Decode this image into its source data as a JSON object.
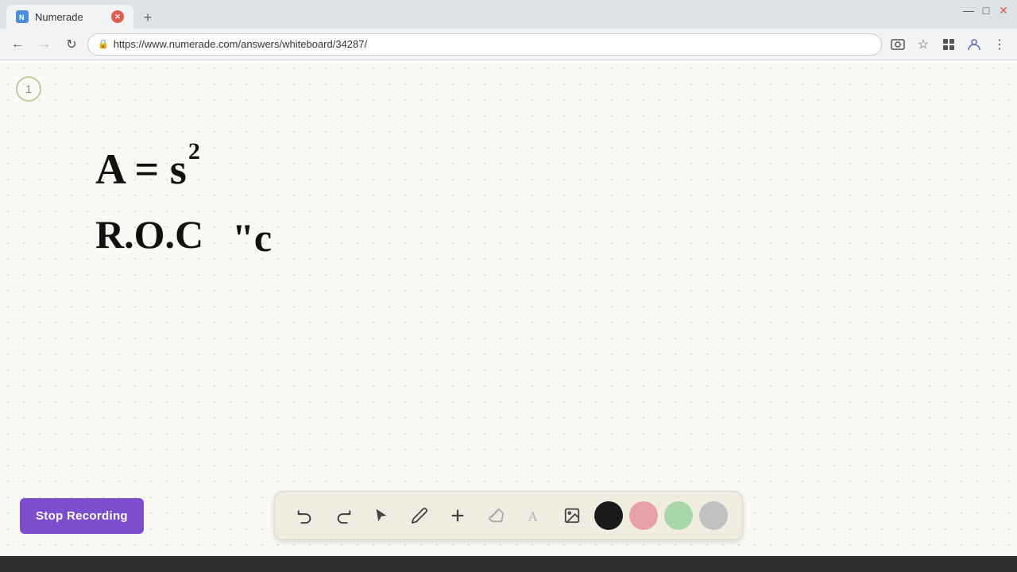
{
  "browser": {
    "tab_title": "Numerade",
    "tab_favicon": "N",
    "url": "https://www.numerade.com/answers/whiteboard/34287/",
    "new_tab_label": "+",
    "back_disabled": false,
    "forward_disabled": true,
    "reload_label": "⟳"
  },
  "toolbar": {
    "undo_label": "↩",
    "redo_label": "↪",
    "select_label": "▶",
    "pen_label": "✏",
    "add_label": "+",
    "eraser_label": "⌫",
    "text_label": "A",
    "image_label": "🖼",
    "colors": [
      {
        "name": "black",
        "hex": "#1a1a1a"
      },
      {
        "name": "pink",
        "hex": "#e8a0a8"
      },
      {
        "name": "green",
        "hex": "#a8d8a8"
      },
      {
        "name": "gray",
        "hex": "#c0c0c0"
      }
    ]
  },
  "whiteboard": {
    "page_number": "1",
    "formula1": "A = s",
    "formula1_exp": "2",
    "formula2": "R.O.C",
    "formula2_cont": "\"c"
  },
  "stop_recording_button": {
    "label": "Stop Recording"
  },
  "window_controls": {
    "minimize": "—",
    "maximize": "□",
    "close": "✕"
  }
}
